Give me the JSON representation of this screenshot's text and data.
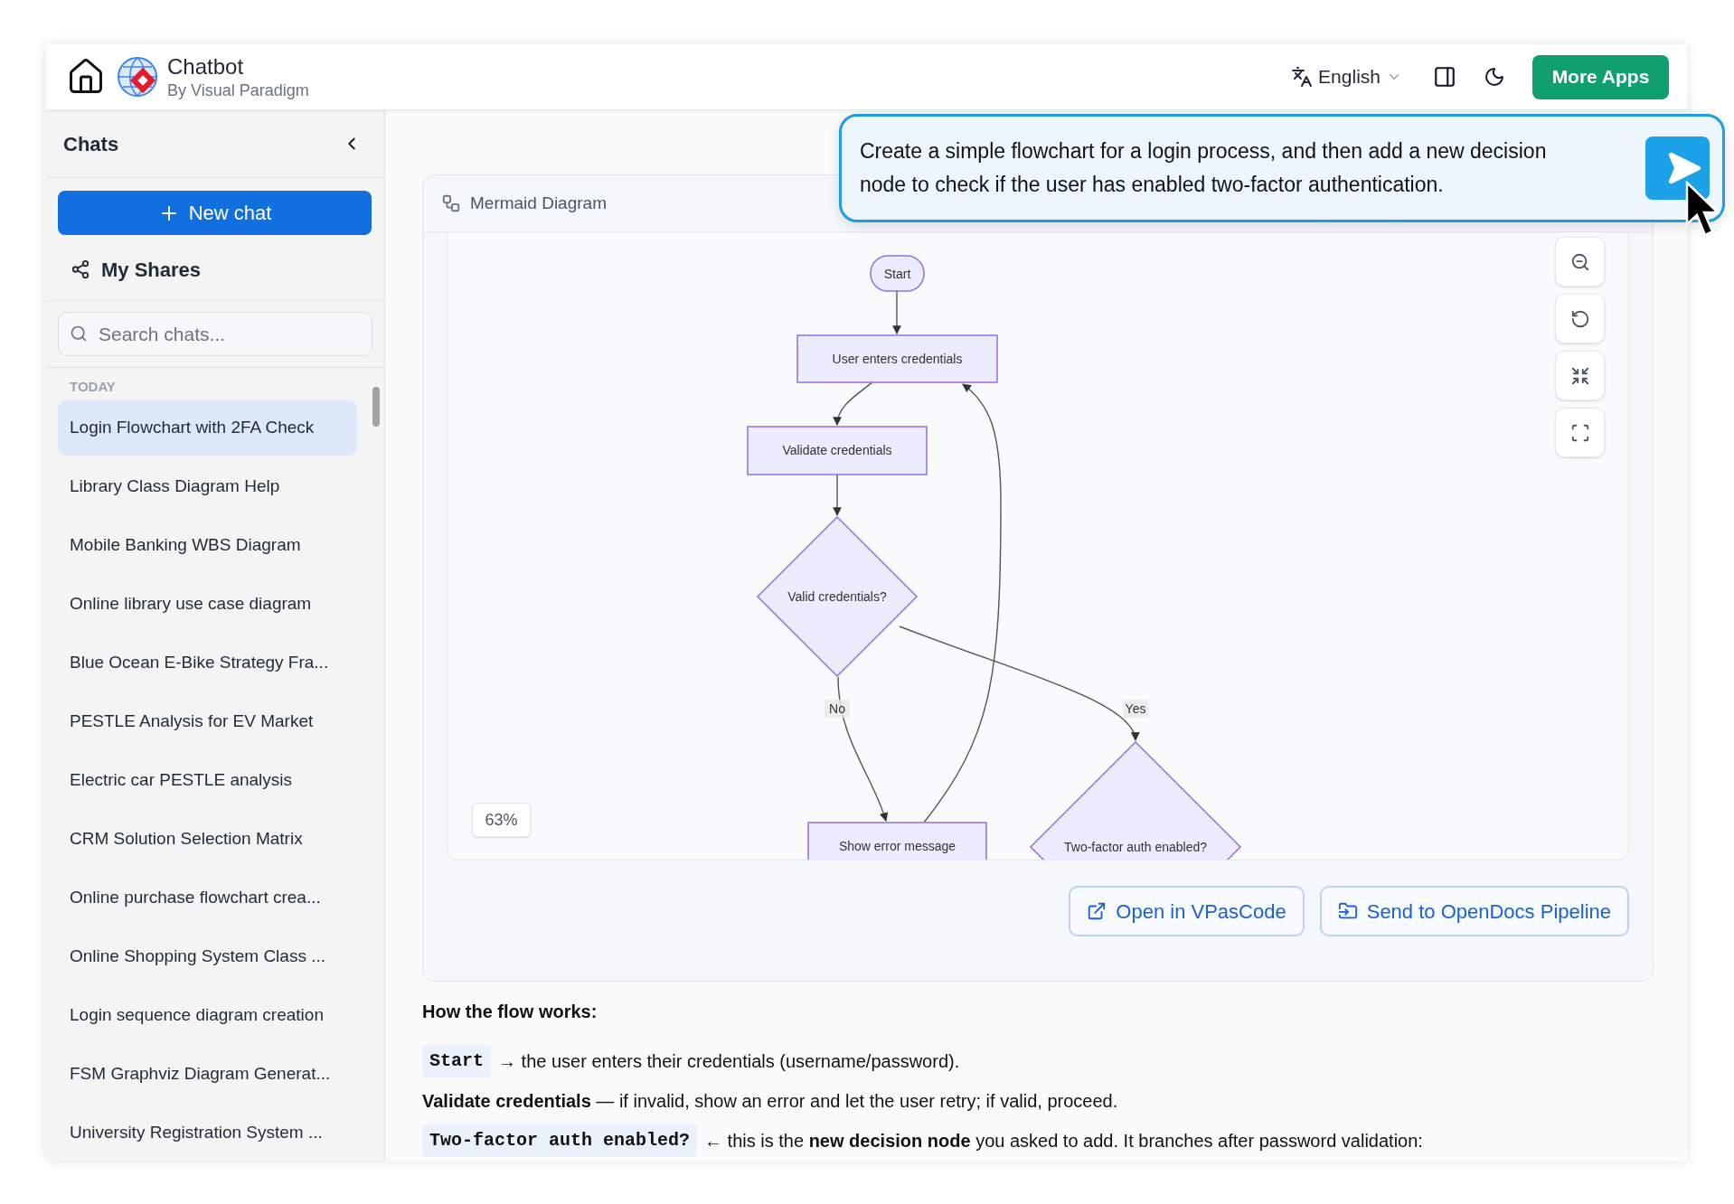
{
  "header": {
    "title": "Chatbot",
    "subtitle": "By Visual Paradigm",
    "language": "English",
    "more_apps": "More Apps"
  },
  "sidebar": {
    "title": "Chats",
    "new_chat": "New chat",
    "my_shares": "My Shares",
    "search": {
      "placeholder": "Search chats..."
    },
    "section": "TODAY",
    "chats": [
      {
        "label": "Login Flowchart with 2FA Check",
        "selected": true
      },
      {
        "label": "Library Class Diagram Help",
        "selected": false
      },
      {
        "label": "Mobile Banking WBS Diagram",
        "selected": false
      },
      {
        "label": "Online library use case diagram",
        "selected": false
      },
      {
        "label": "Blue Ocean E-Bike Strategy Fra...",
        "selected": false
      },
      {
        "label": "PESTLE Analysis for EV Market",
        "selected": false
      },
      {
        "label": "Electric car PESTLE analysis",
        "selected": false
      },
      {
        "label": "CRM Solution Selection Matrix",
        "selected": false
      },
      {
        "label": "Online purchase flowchart crea...",
        "selected": false
      },
      {
        "label": "Online Shopping System Class ...",
        "selected": false
      },
      {
        "label": "Login sequence diagram creation",
        "selected": false
      },
      {
        "label": "FSM Graphviz Diagram Generat...",
        "selected": false
      },
      {
        "label": "University Registration System ...",
        "selected": false
      }
    ]
  },
  "diagram": {
    "title": "Mermaid Diagram",
    "zoom": "63%",
    "nodes": [
      {
        "kind": "terminal",
        "label": "Start"
      },
      {
        "kind": "process",
        "label": "User enters credentials"
      },
      {
        "kind": "process",
        "label": "Validate credentials"
      },
      {
        "kind": "decision",
        "label": "Valid credentials?"
      },
      {
        "kind": "process",
        "label": "Show error message"
      },
      {
        "kind": "decision",
        "label": "Two-factor auth enabled?"
      }
    ],
    "edge_labels": [
      "No",
      "Yes"
    ],
    "actions": [
      {
        "kind": "open",
        "label": "Open in VPasCode"
      },
      {
        "kind": "send",
        "label": "Send to OpenDocs Pipeline"
      }
    ]
  },
  "explanation": {
    "heading": "How the flow works:",
    "lines": [
      {
        "code": "Start",
        "text": "→ the user enters their credentials (username/password)."
      },
      {
        "text": "**Validate credentials** — if invalid, show an error and let the user retry; if valid, proceed."
      },
      {
        "code": "Two-factor auth enabled?",
        "text": "← this is the **new decision node** you asked to add. It branches after password validation:"
      }
    ]
  },
  "prompt": {
    "text": "Create a simple flowchart for a login process, and then add a new decision node to check if the user has enabled two-factor authentication."
  }
}
